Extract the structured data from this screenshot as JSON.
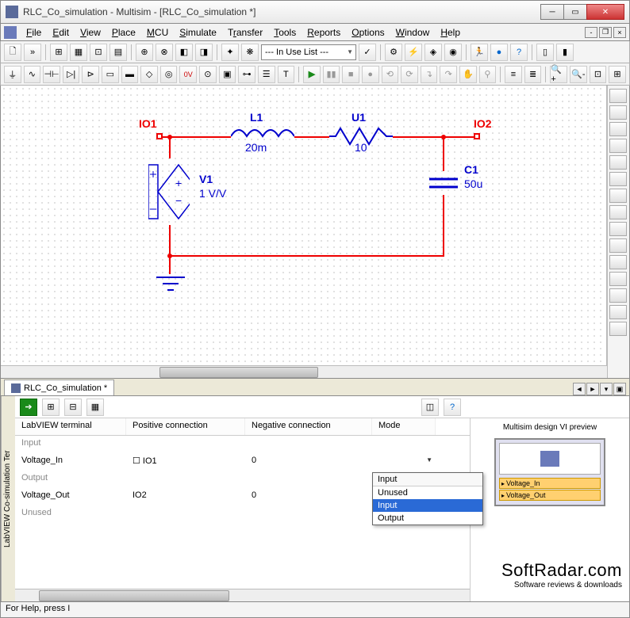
{
  "window": {
    "title": "RLC_Co_simulation - Multisim - [RLC_Co_simulation *]"
  },
  "menu": {
    "items": [
      "File",
      "Edit",
      "View",
      "Place",
      "MCU",
      "Simulate",
      "Transfer",
      "Tools",
      "Reports",
      "Options",
      "Window",
      "Help"
    ]
  },
  "toolbar1": {
    "combo": "--- In Use List ---"
  },
  "tab": {
    "label": "RLC_Co_simulation *"
  },
  "circuit": {
    "io1": "IO1",
    "io2": "IO2",
    "l1_name": "L1",
    "l1_val": "20m",
    "u1_name": "U1",
    "u1_val": "10",
    "c1_name": "C1",
    "c1_val": "50u",
    "v1_name": "V1",
    "v1_val": "1 V/V"
  },
  "bottom": {
    "vtab": "LabVIEW Co-simulation Ter",
    "preview_title": "Multisim design VI preview",
    "cols": {
      "c1": "LabVIEW terminal",
      "c2": "Positive connection",
      "c3": "Negative connection",
      "c4": "Mode"
    },
    "groups": {
      "g1": "Input",
      "g2": "Output",
      "g3": "Unused"
    },
    "rows": {
      "r1": {
        "term": "Voltage_In",
        "pos": "IO1",
        "neg": "0",
        "mode": "Input"
      },
      "r2": {
        "term": "Voltage_Out",
        "pos": "IO2",
        "neg": "0",
        "mode": ""
      }
    },
    "dropdown": {
      "top": "Input",
      "options": [
        "Unused",
        "Input",
        "Output"
      ],
      "selected": "Input"
    },
    "vi": {
      "t1": "Voltage_In",
      "t2": "Voltage_Out"
    }
  },
  "status": "For Help, press I",
  "watermark": {
    "big": "SoftRadar.com",
    "small": "Software reviews & downloads"
  }
}
